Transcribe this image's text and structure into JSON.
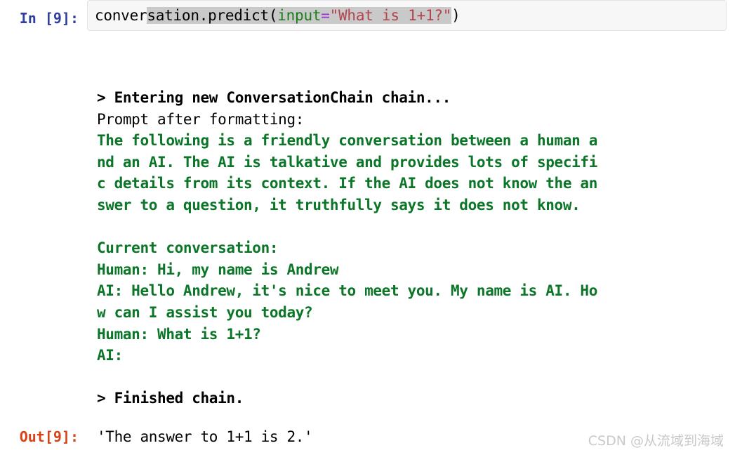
{
  "cell": {
    "input_prompt": "In [9]:",
    "output_prompt": "Out[9]:",
    "code": {
      "full_text": "conversation.predict(input=\"What is 1+1?\")",
      "segments": [
        {
          "text": "conver",
          "type": "plain",
          "selected": false
        },
        {
          "text": "sation.predict(",
          "type": "plain",
          "selected": true
        },
        {
          "text": "input",
          "type": "kwarg",
          "selected": true
        },
        {
          "text": "=",
          "type": "op",
          "selected": true
        },
        {
          "text": "\"What is 1+1?\"",
          "type": "str",
          "selected": true
        },
        {
          "text": ")",
          "type": "plain",
          "selected": false
        }
      ]
    },
    "result_value": "'The answer to 1+1 is 2.'"
  },
  "stream_output": {
    "lines": [
      {
        "text": "> Entering new ConversationChain chain...",
        "style": "bold"
      },
      {
        "text": "Prompt after formatting:",
        "style": "plain"
      },
      {
        "text": "The following is a friendly conversation between a human a",
        "style": "green"
      },
      {
        "text": "nd an AI. The AI is talkative and provides lots of specifi",
        "style": "green"
      },
      {
        "text": "c details from its context. If the AI does not know the an",
        "style": "green"
      },
      {
        "text": "swer to a question, it truthfully says it does not know.",
        "style": "green"
      },
      {
        "text": " ",
        "style": "blank"
      },
      {
        "text": "Current conversation:",
        "style": "green"
      },
      {
        "text": "Human: Hi, my name is Andrew",
        "style": "green"
      },
      {
        "text": "AI: Hello Andrew, it's nice to meet you. My name is AI. Ho",
        "style": "green"
      },
      {
        "text": "w can I assist you today?",
        "style": "green"
      },
      {
        "text": "Human: What is 1+1?",
        "style": "green"
      },
      {
        "text": "AI:",
        "style": "green"
      },
      {
        "text": " ",
        "style": "blank"
      },
      {
        "text": "> Finished chain.",
        "style": "bold"
      }
    ]
  },
  "watermark": {
    "text": "CSDN @从流域到海域"
  },
  "colors": {
    "input_prompt": "#303f9f",
    "output_prompt": "#d84315",
    "verbose_green": "#0b7528",
    "string_literal": "#b3434c",
    "keyword_arg": "#1a7d1a",
    "operator": "#9b30d9",
    "selection": "#c9c9c9",
    "cell_background": "#f7f7f7"
  }
}
